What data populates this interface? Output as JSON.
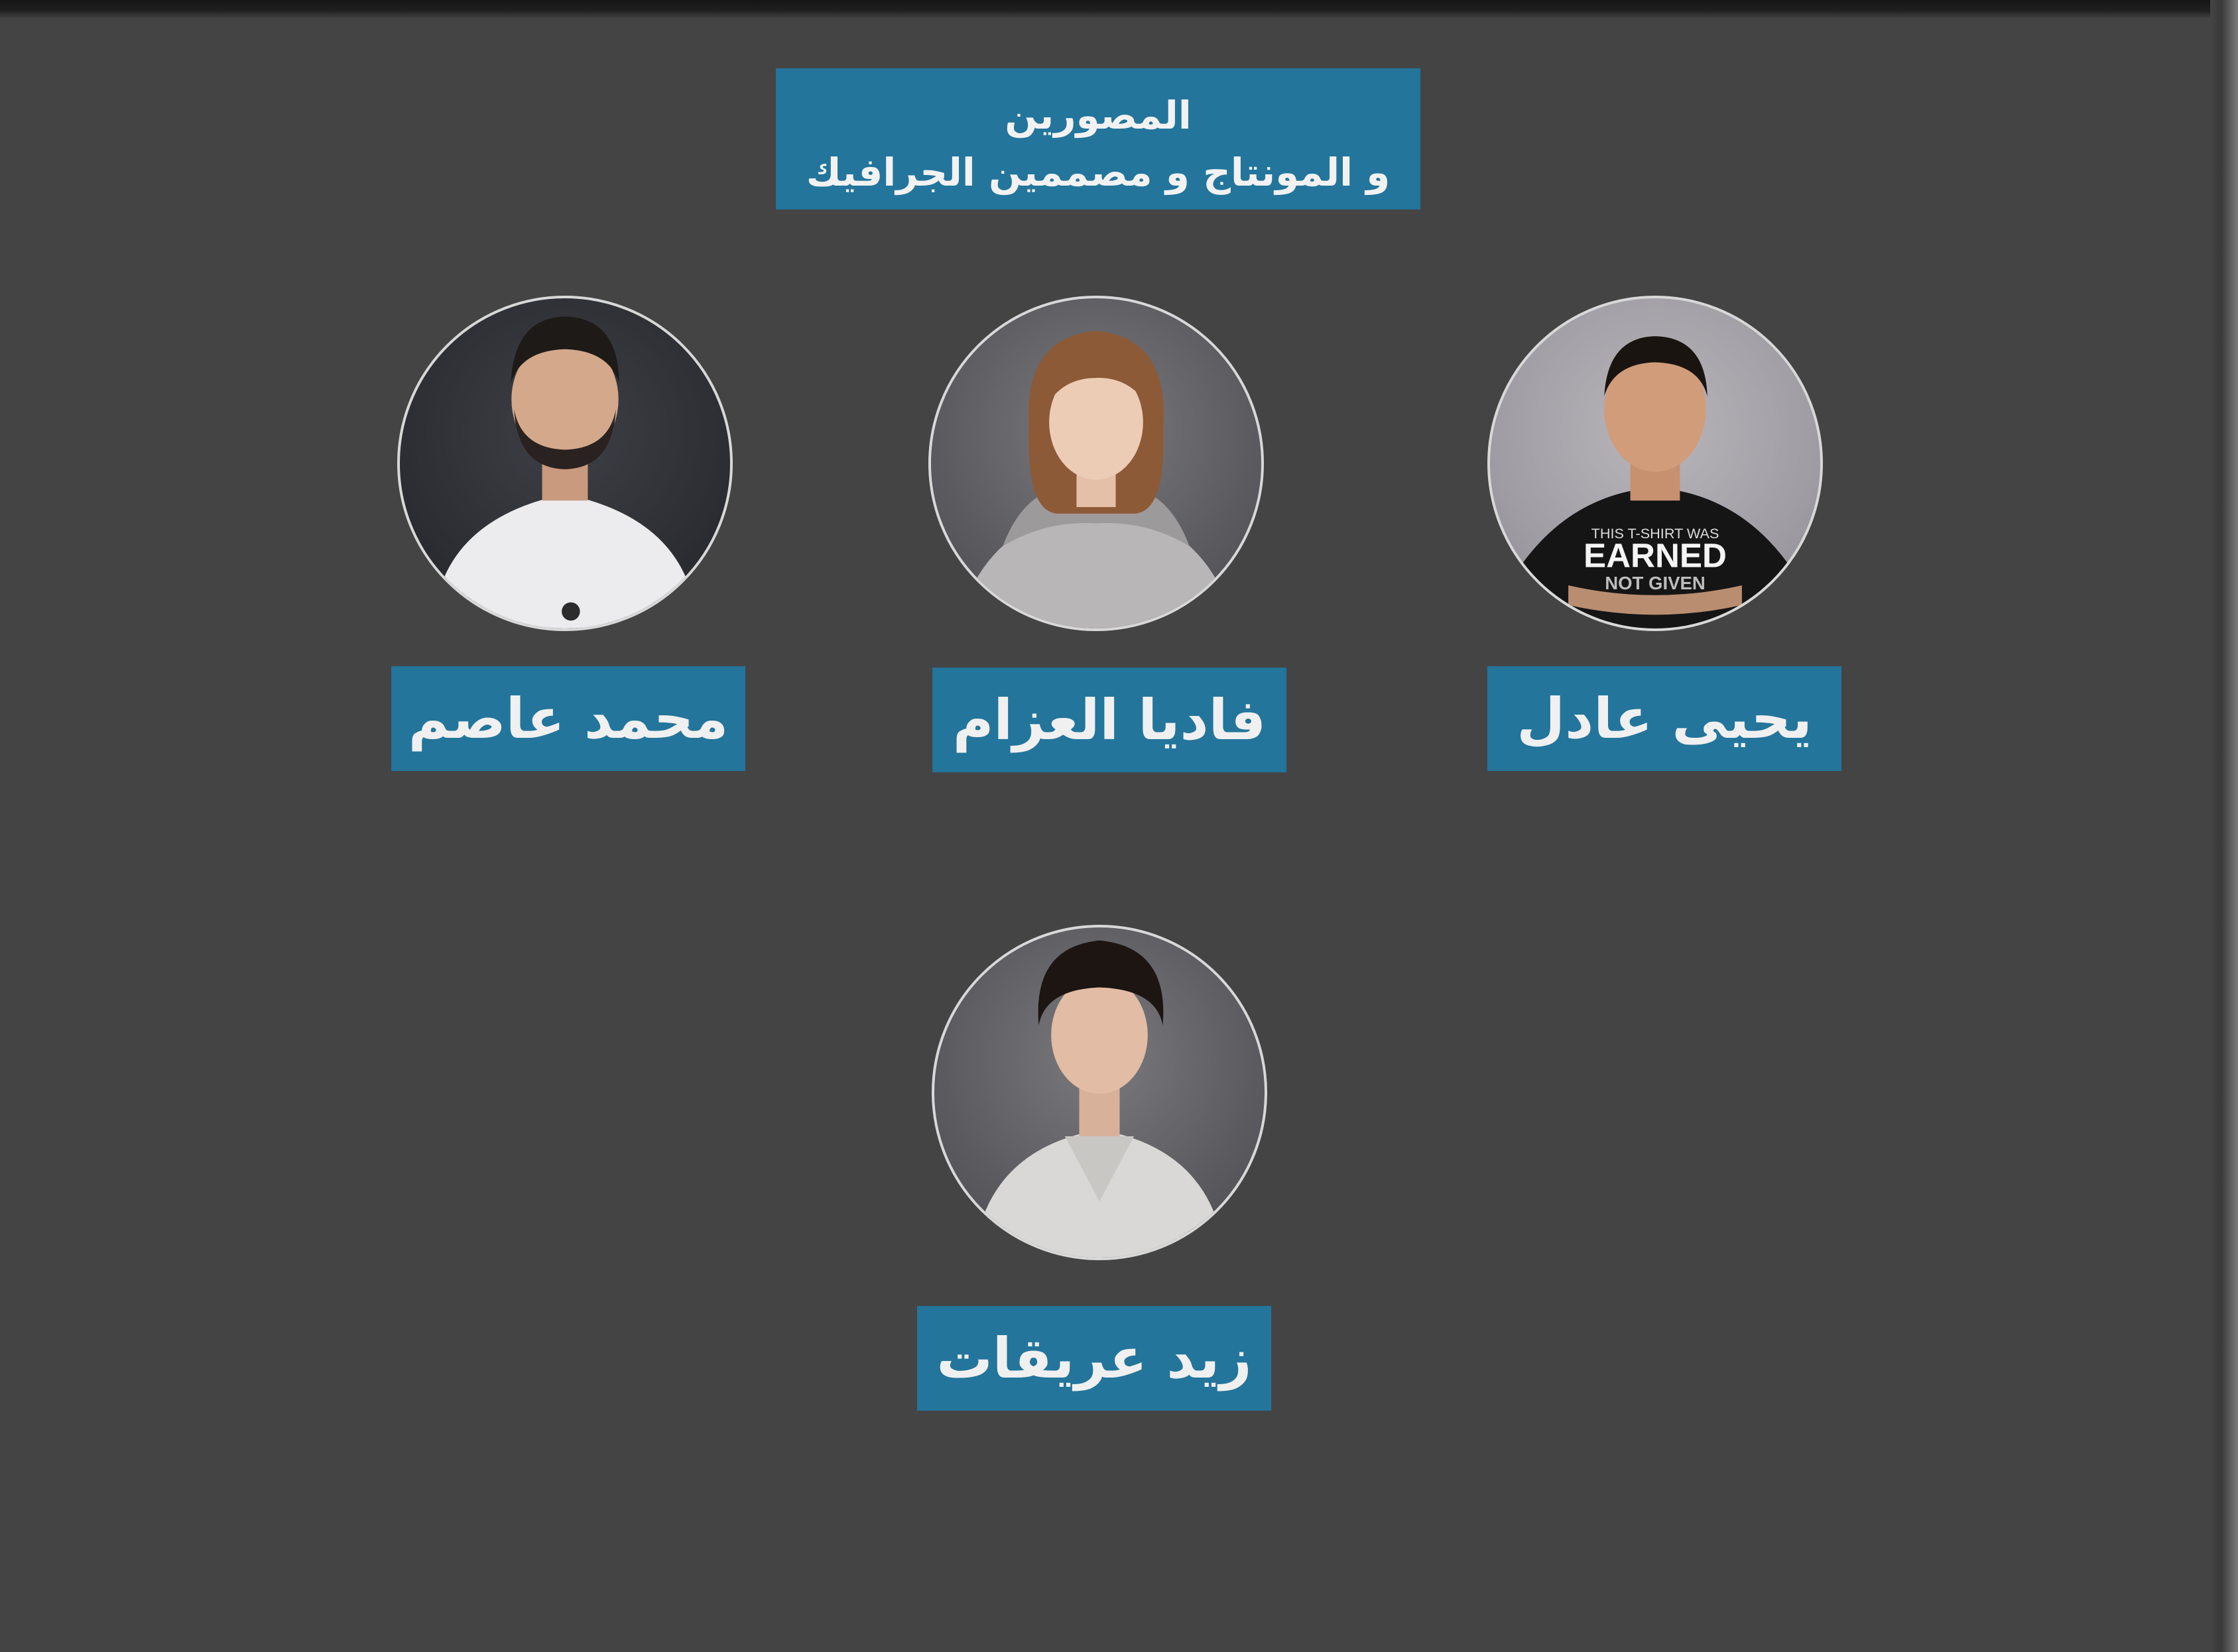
{
  "header": {
    "title_line1": "المصورين",
    "title_line2": "و المونتاج و مصممين الجرافيك"
  },
  "members": [
    {
      "name": "يحيى عادل",
      "shirt_text_1": "THIS T-SHIRT WAS",
      "shirt_text_2": "EARNED",
      "shirt_text_3": "NOT GIVEN"
    },
    {
      "name": "فاديا العزام"
    },
    {
      "name": "محمد عاصم"
    },
    {
      "name": "زيد عريقات"
    }
  ],
  "colors": {
    "background": "#444444",
    "label_blue": "#23759b",
    "label_text": "#f0f0f0",
    "avatar_border": "#d8d8d8"
  }
}
